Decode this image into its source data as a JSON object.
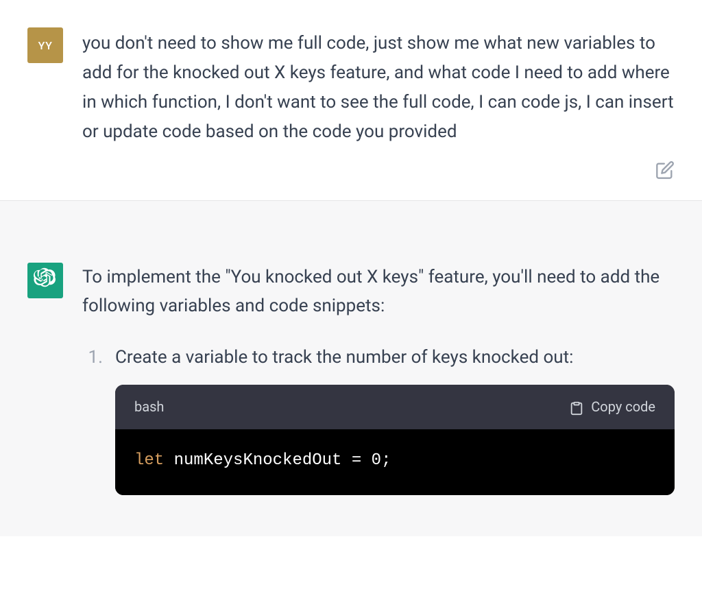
{
  "user": {
    "avatar_initials": "YY",
    "message": "you don't need to show me full code, just show me what new variables to add for the knocked out X keys feature, and what code I need to add where in which function, I don't want to see the full code, I can code js, I can insert or update code based on the code you provided"
  },
  "assistant": {
    "intro": "To implement the \"You knocked out X keys\" feature, you'll need to add the following variables and code snippets:",
    "list": [
      {
        "marker": "1.",
        "text": "Create a variable to track the number of keys knocked out:",
        "code": {
          "language": "bash",
          "copy_label": "Copy code",
          "tokens": {
            "keyword": "let",
            "rest": " numKeysKnockedOut = 0;"
          }
        }
      }
    ]
  }
}
